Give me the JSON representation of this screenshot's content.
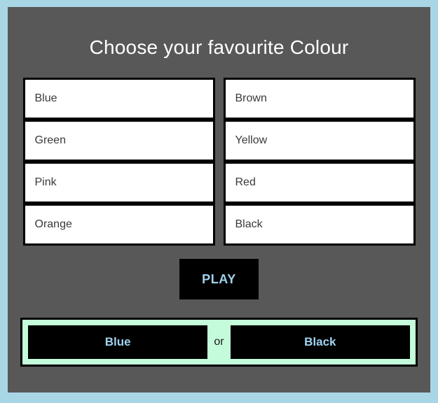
{
  "app": {
    "title": "Choose your favourite Colour",
    "background_color": "#a9d6e5",
    "panel_color": "#585858"
  },
  "options": {
    "left_column": [
      {
        "label": "Blue"
      },
      {
        "label": "Green"
      },
      {
        "label": "Pink"
      },
      {
        "label": "Orange"
      }
    ],
    "right_column": [
      {
        "label": "Brown"
      },
      {
        "label": "Yellow"
      },
      {
        "label": "Red"
      },
      {
        "label": "Black"
      }
    ]
  },
  "actions": {
    "play_label": "PLAY"
  },
  "result": {
    "first_choice": "Blue",
    "separator": "or",
    "second_choice": "Black",
    "bar_color": "#c4fcdb",
    "text_color": "#9fd3f0"
  }
}
